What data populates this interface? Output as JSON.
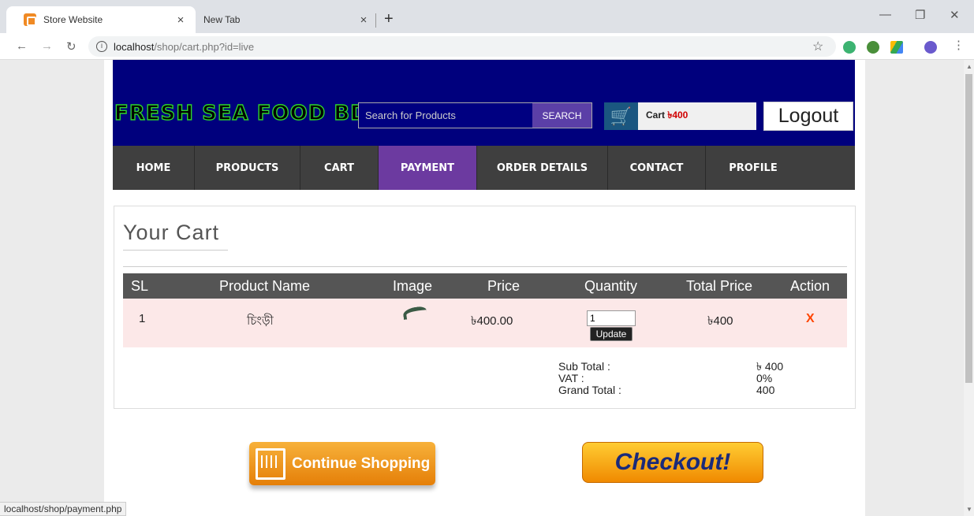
{
  "browser": {
    "tabs": [
      {
        "title": "Store Website",
        "active": true
      },
      {
        "title": "New Tab",
        "active": false
      }
    ],
    "new_tab": "+",
    "close": "×",
    "url_host": "localhost",
    "url_path": "/shop/cart.php?id=live",
    "status_url": "localhost/shop/payment.php",
    "icons": [
      "back-icon",
      "forward-icon",
      "reload-icon",
      "info-icon",
      "star-icon",
      "extension-icon",
      "profile-icon",
      "menu-icon"
    ]
  },
  "header": {
    "logo": "FRESH SEA FOOD BD",
    "search_placeholder": "Search for Products",
    "search_button": "SEARCH",
    "cart_label": "Cart ",
    "cart_amount": "৳400",
    "logout": "Logout"
  },
  "menu": [
    {
      "label": "HOME",
      "active": false
    },
    {
      "label": "PRODUCTS",
      "active": false
    },
    {
      "label": "CART",
      "active": false
    },
    {
      "label": "PAYMENT",
      "active": true
    },
    {
      "label": "ORDER DETAILS",
      "active": false
    },
    {
      "label": "CONTACT",
      "active": false
    },
    {
      "label": "PROFILE",
      "active": false
    }
  ],
  "cart": {
    "title": "Your Cart",
    "columns": [
      "SL",
      "Product Name",
      "Image",
      "Price",
      "Quantity",
      "Total Price",
      "Action"
    ],
    "rows": [
      {
        "sl": "1",
        "name": "চিংড়ী",
        "price": "৳400.00",
        "quantity": "1",
        "update": "Update",
        "total": "৳400",
        "action": "X"
      }
    ],
    "subtotal_label": "Sub Total :",
    "subtotal_value": "৳ 400",
    "vat_label": "VAT :",
    "vat_value": "0%",
    "grand_label": "Grand Total :",
    "grand_value": "400"
  },
  "buttons": {
    "continue": "Continue Shopping",
    "checkout": "Checkout!"
  },
  "colors": {
    "header_bg": "#00007d",
    "menu_bg": "#3f3f3f",
    "menu_active": "#6c3aa0",
    "logo": "#2dd22d",
    "accent_red": "#d00000"
  }
}
